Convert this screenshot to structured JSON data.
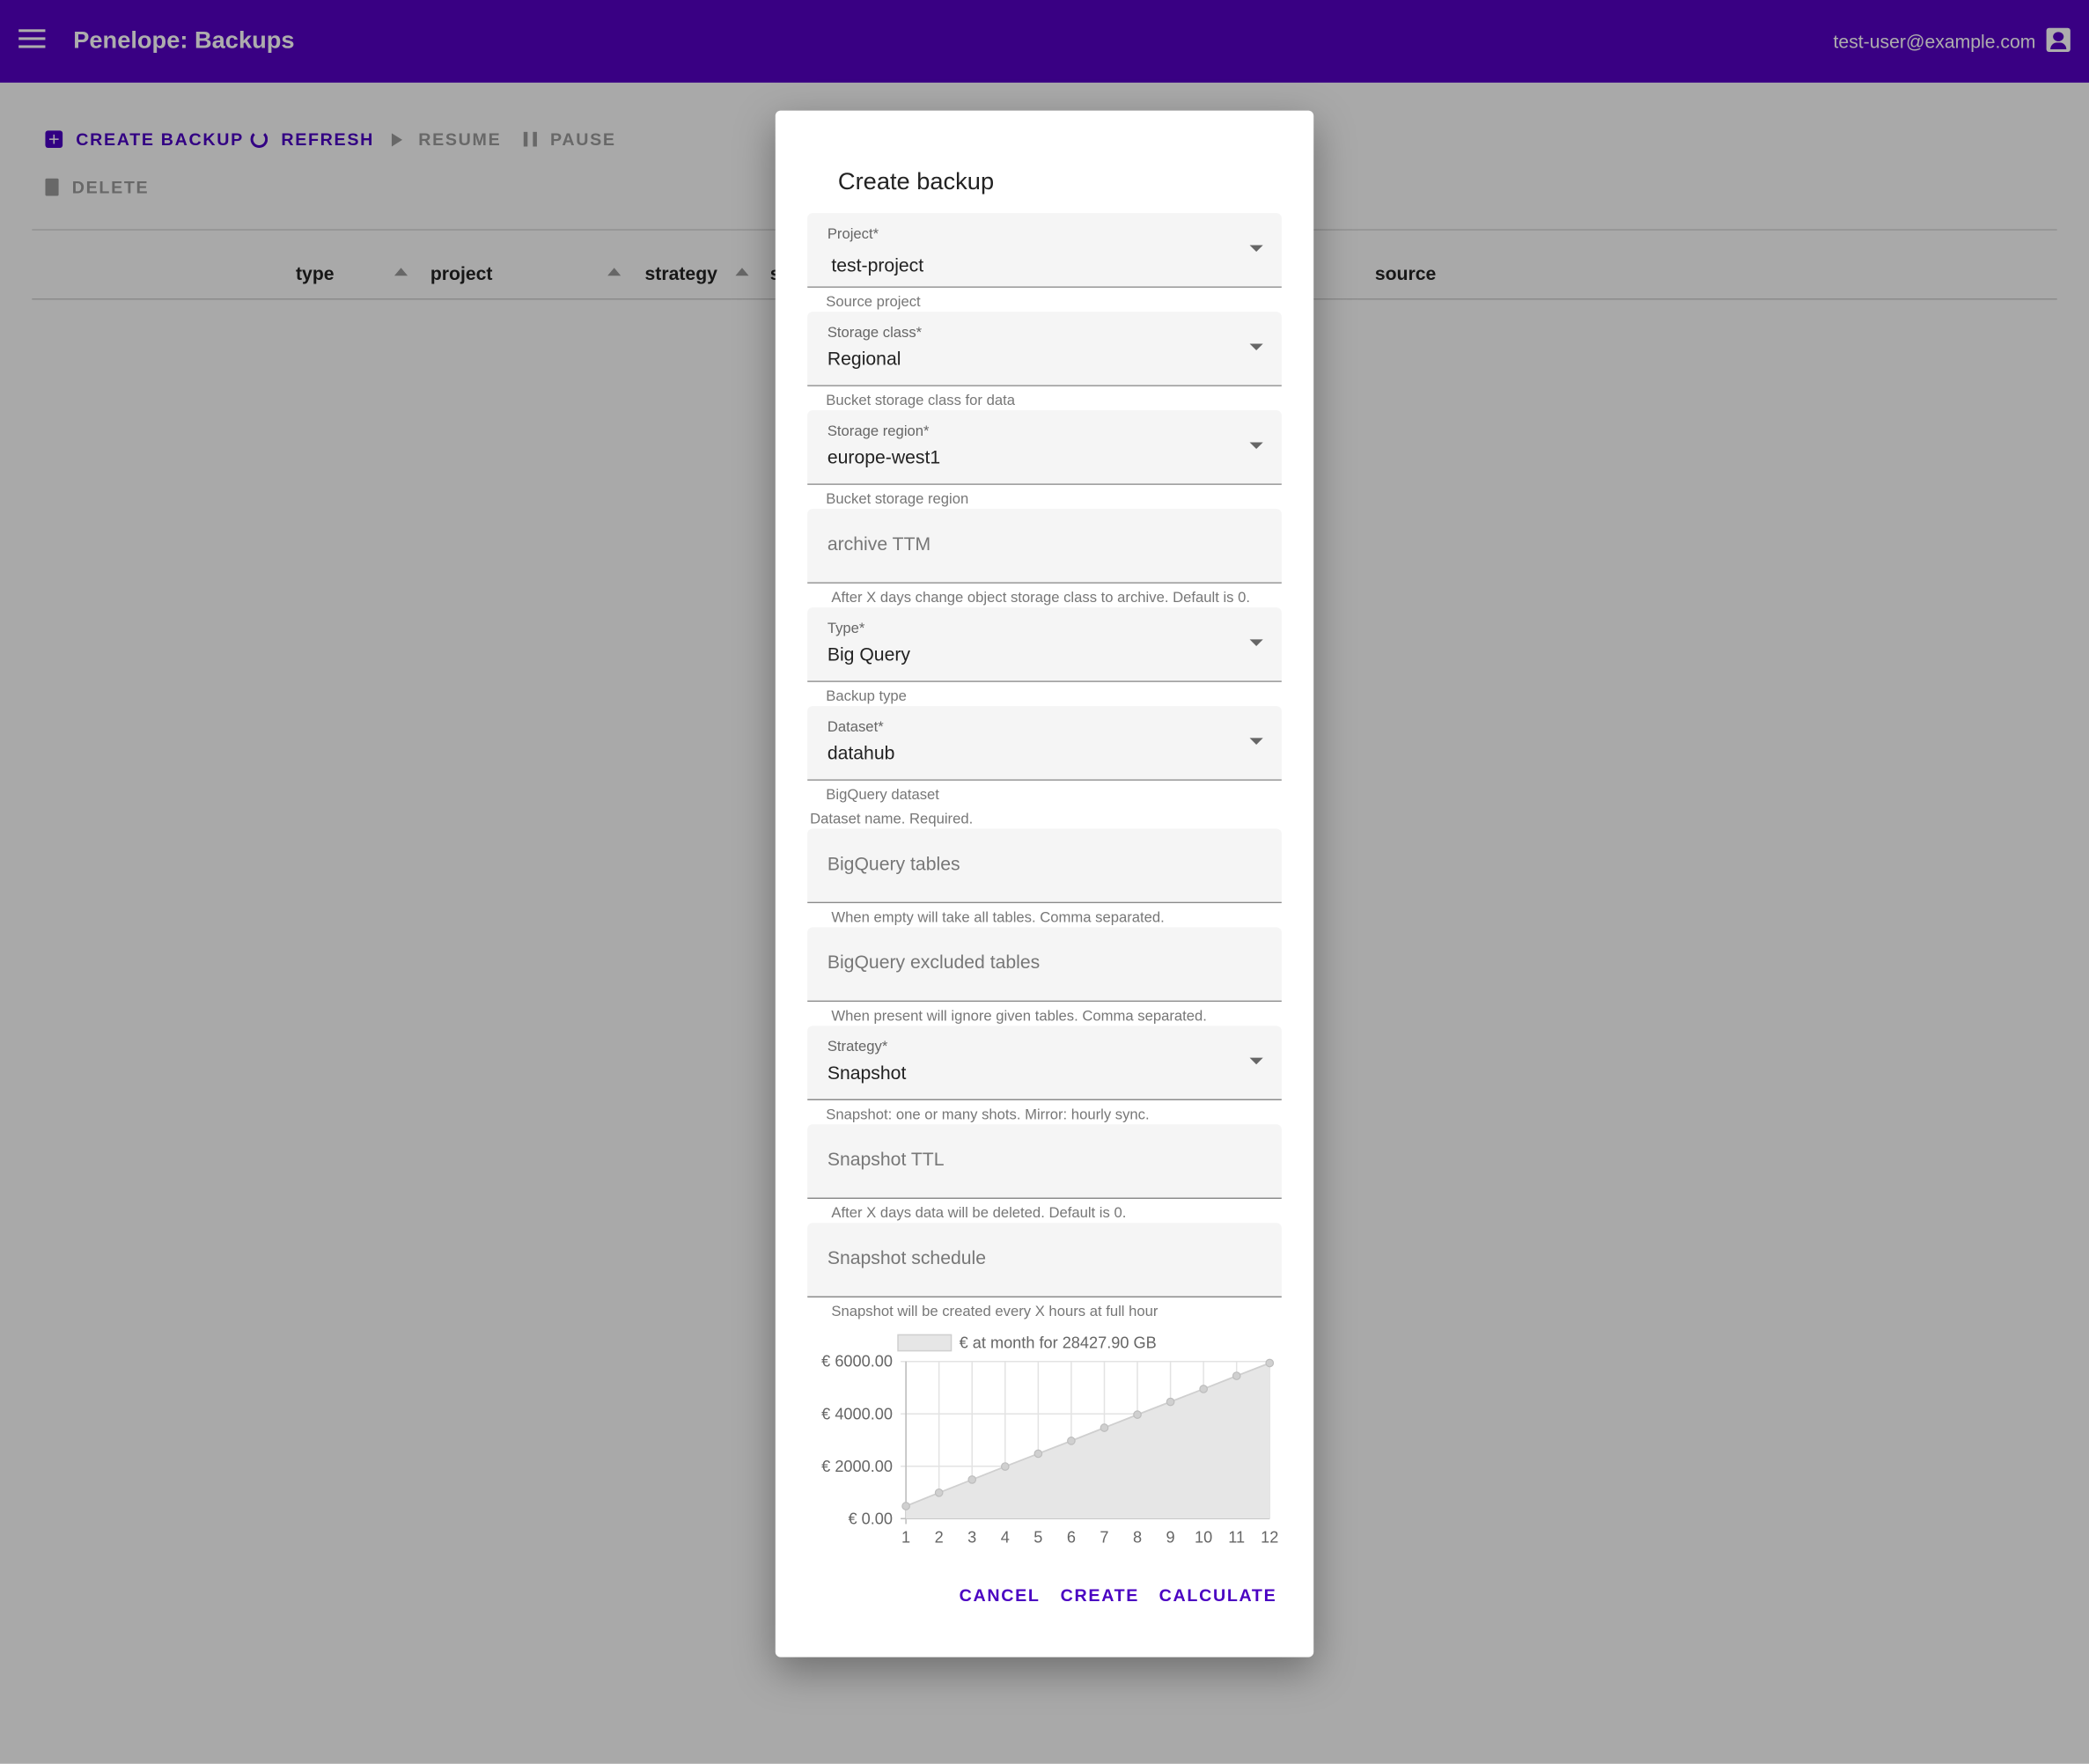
{
  "app": {
    "title": "Penelope: Backups",
    "user_email": "test-user@example.com"
  },
  "toolbar": {
    "create_label": "CREATE BACKUP",
    "refresh_label": "REFRESH",
    "resume_label": "RESUME",
    "pause_label": "PAUSE",
    "delete_label": "DELETE"
  },
  "table": {
    "columns": [
      "type",
      "project",
      "strategy",
      "s",
      "source"
    ]
  },
  "dialog": {
    "title": "Create backup",
    "fields": {
      "project": {
        "label": "Project*",
        "value": "test-project",
        "hint": "Source project"
      },
      "storage_class": {
        "label": "Storage class*",
        "value": "Regional",
        "hint": "Bucket storage class for data"
      },
      "storage_region": {
        "label": "Storage region*",
        "value": "europe-west1",
        "hint": "Bucket storage region"
      },
      "archive_ttm": {
        "placeholder": "archive TTM",
        "hint": "After X days change object storage class to archive. Default is 0."
      },
      "type": {
        "label": "Type*",
        "value": "Big Query",
        "hint": "Backup type"
      },
      "dataset": {
        "label": "Dataset*",
        "value": "datahub",
        "hint": "BigQuery dataset",
        "extra_hint": "Dataset name. Required."
      },
      "bq_tables": {
        "placeholder": "BigQuery tables",
        "hint": "When empty will take all tables. Comma separated."
      },
      "bq_excluded": {
        "placeholder": "BigQuery excluded tables",
        "hint": "When present will ignore given tables. Comma separated."
      },
      "strategy": {
        "label": "Strategy*",
        "value": "Snapshot",
        "hint": "Snapshot: one or many shots. Mirror: hourly sync."
      },
      "snapshot_ttl": {
        "placeholder": "Snapshot TTL",
        "hint": "After X days data will be deleted. Default is 0."
      },
      "snapshot_schedule": {
        "placeholder": "Snapshot schedule",
        "hint": "Snapshot will be created every X hours at full hour"
      }
    },
    "actions": {
      "cancel": "CANCEL",
      "create": "CREATE",
      "calculate": "CALCULATE"
    }
  },
  "chart_data": {
    "type": "area",
    "x": [
      1,
      2,
      3,
      4,
      5,
      6,
      7,
      8,
      9,
      10,
      11,
      12
    ],
    "series": [
      {
        "name": "€ at month for 28427.90 GB",
        "values": [
          480,
          990,
          1490,
          1990,
          2480,
          2970,
          3470,
          3970,
          4460,
          4950,
          5450,
          5940
        ]
      }
    ],
    "y_ticks": [
      "€ 0.00",
      "€ 2000.00",
      "€ 4000.00",
      "€ 6000.00"
    ],
    "ylim": [
      0,
      6000
    ],
    "grid": true,
    "legend": "top",
    "colors": {
      "fill": "#e6e6e6",
      "line": "#cfcfcf",
      "point": "#c7c7c7"
    }
  }
}
